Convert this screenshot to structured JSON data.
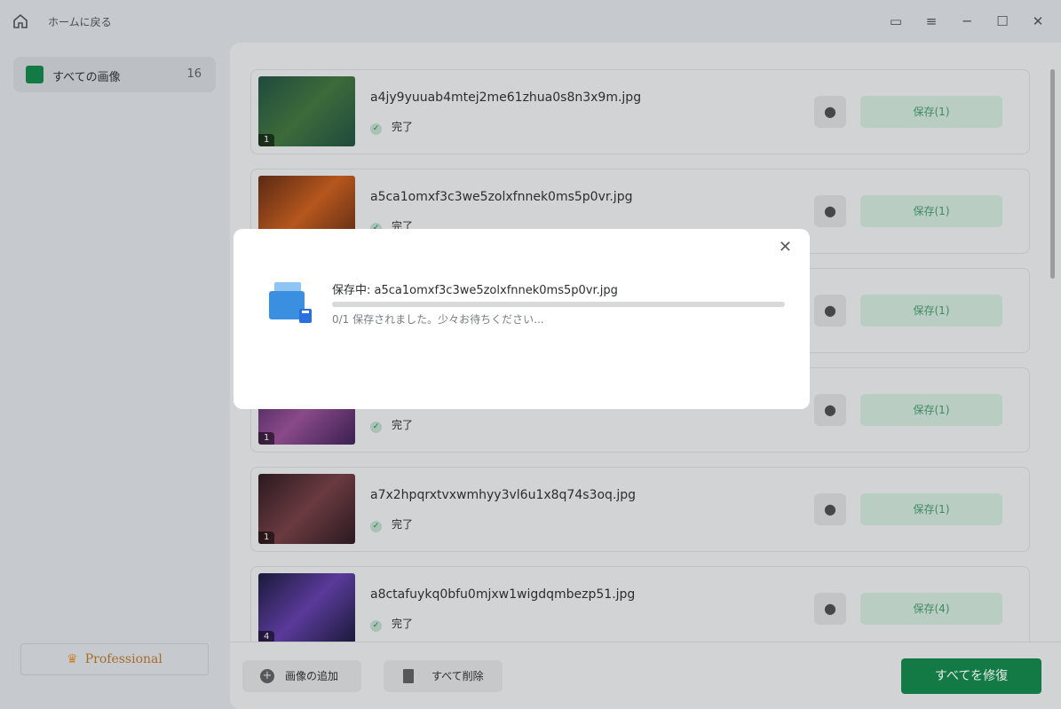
{
  "titlebar": {
    "home_label": "ホームに戻る"
  },
  "sidebar": {
    "items": [
      {
        "label": "すべての画像",
        "count": "16"
      }
    ],
    "pro_label": "Professional"
  },
  "files": [
    {
      "name": "a4jy9yuuab4mtej2me61zhua0s8n3x9m.jpg",
      "status": "完了",
      "badge": "1",
      "save": "保存(1)",
      "colors": [
        "#1f4a3e",
        "#3d6b3a"
      ]
    },
    {
      "name": "a5ca1omxf3c3we5zolxfnnek0ms5p0vr.jpg",
      "status": "完了",
      "badge": "",
      "save": "保存(1)",
      "colors": [
        "#5a2a14",
        "#b5561d"
      ]
    },
    {
      "name": "",
      "status": "",
      "badge": "",
      "save": "保存(1)",
      "colors": [
        "#2a2a3a",
        "#554466"
      ]
    },
    {
      "name": "",
      "status": "完了",
      "badge": "1",
      "save": "保存(1)",
      "colors": [
        "#3a2050",
        "#8a4a8a"
      ]
    },
    {
      "name": "a7x2hpqrxtvxwmhyy3vl6u1x8q74s3oq.jpg",
      "status": "完了",
      "badge": "1",
      "save": "保存(1)",
      "colors": [
        "#2a1a20",
        "#6a3a40"
      ]
    },
    {
      "name": "a8ctafuykq0bfu0mjxw1wigdqmbezp51.jpg",
      "status": "完了",
      "badge": "4",
      "save": "保存(4)",
      "colors": [
        "#1a1a3a",
        "#5a3a9a"
      ]
    }
  ],
  "bottom": {
    "add_label": "画像の追加",
    "delete_label": "すべて削除",
    "repair_label": "すべてを修復"
  },
  "dialog": {
    "title": "保存中: a5ca1omxf3c3we5zolxfnnek0ms5p0vr.jpg",
    "progress": 0,
    "message": "0/1 保存されました。少々お待ちください..."
  },
  "colors": {
    "accent": "#137a45"
  }
}
